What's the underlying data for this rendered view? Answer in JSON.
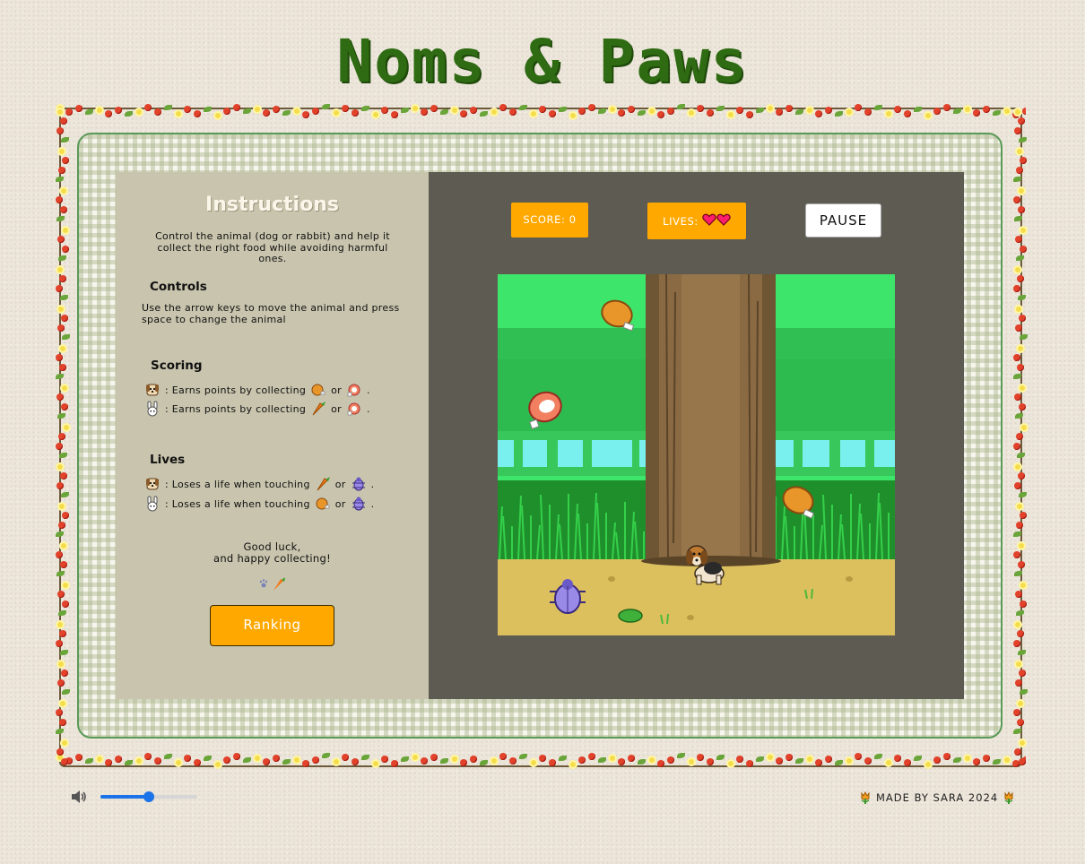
{
  "header": {
    "title": "Noms & Paws"
  },
  "instructions": {
    "title": "Instructions",
    "intro": "Control the animal (dog or rabbit) and help it collect the right food while avoiding harmful ones.",
    "controls_heading": "Controls",
    "controls_text": "Use the arrow keys to move the animal and press space to change the animal",
    "scoring_heading": "Scoring",
    "scoring_dog": ": Earns points by collecting",
    "scoring_rabbit": ": Earns points by collecting",
    "or": "or",
    "period": ".",
    "lives_heading": "Lives",
    "lives_dog": ": Loses a life when touching",
    "lives_rabbit": ": Loses a life when touching",
    "luck_line1": "Good luck,",
    "luck_line2": "and happy collecting!",
    "ranking_button": "Ranking"
  },
  "hud": {
    "score_label": "SCORE: 0",
    "lives_label": "LIVES:",
    "lives": 2,
    "pause_label": "PAUSE"
  },
  "footer": {
    "credit": "MADE BY SARA 2024",
    "volume_level": 0.5
  },
  "colors": {
    "accent": "#ffa800",
    "title_green": "#2e6b12",
    "panel_left": "#c8c4ad",
    "panel_right": "#5e5b52",
    "slider_blue": "#1a73e8"
  }
}
